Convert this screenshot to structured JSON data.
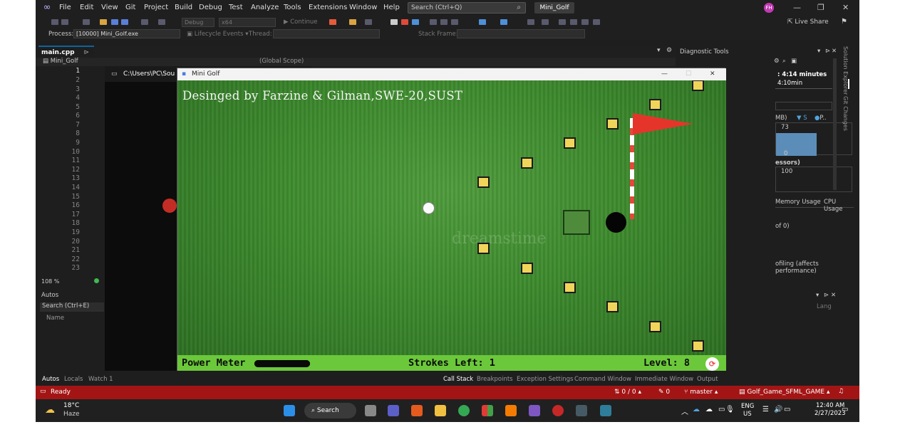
{
  "vs": {
    "menu": [
      "File",
      "Edit",
      "View",
      "Git",
      "Project",
      "Build",
      "Debug",
      "Test",
      "Analyze",
      "Tools",
      "Extensions",
      "Window",
      "Help"
    ],
    "search_placeholder": "Search (Ctrl+Q)",
    "solution_title": "Mini_Golf",
    "avatar_initials": "FH",
    "live_share": "Live Share",
    "process_label": "Process:",
    "process_value": "[10000] Mini_Golf.exe",
    "lifecycle": "Lifecycle Events",
    "thread": "Thread:",
    "stack_frame": "Stack Frame:",
    "config": "Debug",
    "platform": "x64",
    "continue": "Continue"
  },
  "editor": {
    "tab_label": "main.cpp",
    "scope_left": "Mini_Golf",
    "scope_right": "(Global Scope)",
    "line_numbers": [
      "1",
      "2",
      "3",
      "4",
      "5",
      "6",
      "7",
      "8",
      "9",
      "10",
      "11",
      "12",
      "13",
      "14",
      "15",
      "16",
      "17",
      "18",
      "19",
      "20",
      "21",
      "22",
      "23"
    ],
    "zoom": "108 %"
  },
  "console": {
    "title": "C:\\Users\\PC\\Sou"
  },
  "game": {
    "window_title": "Mini Golf",
    "heading": "Desinged by Farzine & Gilman,SWE-20,SUST",
    "power_label": "Power Meter",
    "power_level": 1.0,
    "strokes_label": "Strokes Left: 1",
    "level_label": "Level: 8",
    "watermark": "dreamstime"
  },
  "diagnostics": {
    "title": "Diagnostic Tools",
    "session": ": 4:14 minutes",
    "timeline": "4:10min",
    "mem_label": "MB)",
    "legend_s": "S",
    "legend_p": "P..",
    "val73": "73",
    "val0": "0",
    "val100": "100",
    "cpu_label": "essors)",
    "tab_memory": "Memory Usage",
    "tab_cpu": "CPU Usage",
    "events": "of 0)",
    "profiling": "ofiling (affects performance)",
    "lang": "Lang"
  },
  "right_side": {
    "solution_explorer": "Solution Explorer",
    "git_changes": "Git Changes"
  },
  "autos": {
    "title": "Autos",
    "search": "Search (Ctrl+E)",
    "col_name": "Name"
  },
  "bottom_tabs": {
    "left": [
      "Autos",
      "Locals",
      "Watch 1"
    ],
    "right": [
      "Call Stack",
      "Breakpoints",
      "Exception Settings",
      "Command Window",
      "Immediate Window",
      "Output"
    ]
  },
  "status": {
    "ready": "Ready",
    "changes": "0 / 0",
    "pencil": "0",
    "branch": "master",
    "repo": "Golf_Game_SFML_GAME"
  },
  "taskbar": {
    "weather_temp": "18°C",
    "weather_desc": "Haze",
    "search": "Search",
    "lang1": "ENG",
    "lang2": "US",
    "time": "12:40 AM",
    "date": "2/27/2023"
  }
}
